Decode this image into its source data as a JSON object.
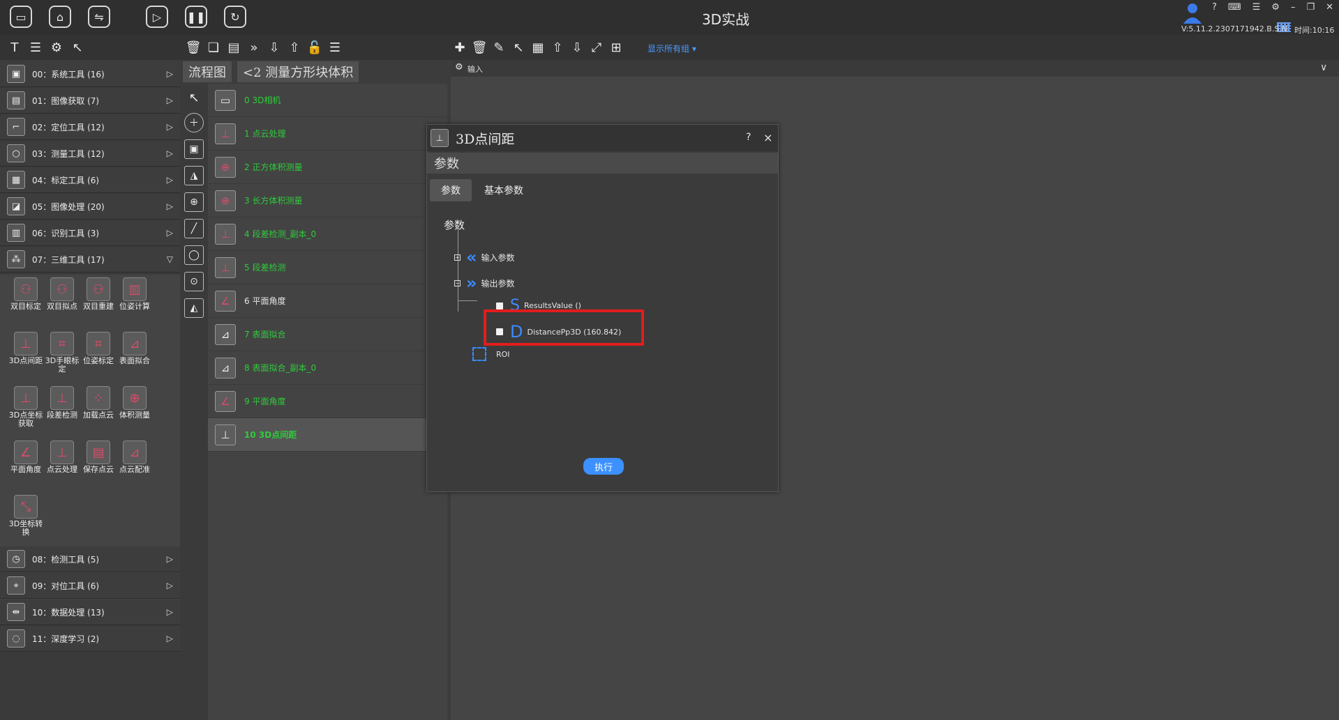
{
  "window": {
    "title": "3D实战",
    "version": "V:5.11.2.2307171942.B.S.N",
    "clock": "时间:10:16",
    "help_glyph": "?"
  },
  "left_panel": {
    "categories": [
      {
        "label": "00：系统工具 (16)"
      },
      {
        "label": "01：图像获取 (7)"
      },
      {
        "label": "02：定位工具 (12)"
      },
      {
        "label": "03：测量工具 (12)"
      },
      {
        "label": "04：标定工具 (6)"
      },
      {
        "label": "05：图像处理 (20)"
      },
      {
        "label": "06：识别工具 (3)"
      },
      {
        "label": "07：三维工具 (17)"
      },
      {
        "label": "08：检测工具 (5)"
      },
      {
        "label": "09：对位工具 (6)"
      },
      {
        "label": "10：数据处理 (13)"
      },
      {
        "label": "11：深度学习 (2)"
      }
    ],
    "tools": [
      {
        "label": "双目标定"
      },
      {
        "label": "双目拟点"
      },
      {
        "label": "双目重建"
      },
      {
        "label": "位姿计算"
      },
      {
        "label": "3D点间距"
      },
      {
        "label": "3D手眼标定"
      },
      {
        "label": "位姿标定"
      },
      {
        "label": "表面拟合"
      },
      {
        "label": "3D点坐标获取"
      },
      {
        "label": "段差检测"
      },
      {
        "label": "加载点云"
      },
      {
        "label": "体积测量"
      },
      {
        "label": "平面角度"
      },
      {
        "label": "点云处理"
      },
      {
        "label": "保存点云"
      },
      {
        "label": "点云配准"
      },
      {
        "label": "3D坐标转换"
      }
    ]
  },
  "flow": {
    "tab_label": "流程图",
    "back_label": "<2  测量方形块体积",
    "items": [
      {
        "label": "0  3D相机"
      },
      {
        "label": "1  点云处理"
      },
      {
        "label": "2  正方体积测量"
      },
      {
        "label": "3  长方体积测量"
      },
      {
        "label": "4  段差检测_副本_0"
      },
      {
        "label": "5  段差检测"
      },
      {
        "label": "6  平面角度"
      },
      {
        "label": "7  表面拟合"
      },
      {
        "label": "8  表面拟合_副本_0"
      },
      {
        "label": "9  平面角度"
      },
      {
        "label": "10 3D点间距"
      }
    ]
  },
  "canvas": {
    "show_groups": "显示所有组",
    "input_label": "输入"
  },
  "dialog": {
    "title": "3D点间距",
    "section": "参数",
    "tabs": [
      {
        "label": "参数"
      },
      {
        "label": "基本参数"
      }
    ],
    "group_label": "参数",
    "tree": {
      "input": "输入参数",
      "output": "输出参数",
      "results": "ResultsValue  ()",
      "distance": "DistancePp3D  (160.842)",
      "roi": "ROI",
      "s_glyph": "S",
      "d_glyph": "D"
    },
    "run_label": "执行",
    "close_glyph": "×"
  },
  "colors": {
    "accent": "#3c90ff",
    "highlight": "#e31c1c",
    "flow_text": "#2fcb3c"
  }
}
